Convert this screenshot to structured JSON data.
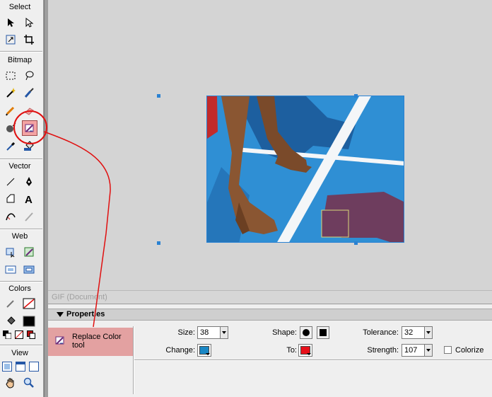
{
  "tools_panel": {
    "sections": [
      {
        "title": "Select"
      },
      {
        "title": "Bitmap"
      },
      {
        "title": "Vector"
      },
      {
        "title": "Web"
      },
      {
        "title": "Colors"
      },
      {
        "title": "View"
      }
    ]
  },
  "stage": {
    "document_label": "GIF (Document)"
  },
  "properties": {
    "title": "Properties",
    "tool_name": "Replace Color tool",
    "size_label": "Size:",
    "size_value": "38",
    "change_label": "Change:",
    "change_color": "#1a87c5",
    "shape_label": "Shape:",
    "to_label": "To:",
    "to_color": "#e8101a",
    "tolerance_label": "Tolerance:",
    "tolerance_value": "32",
    "strength_label": "Strength:",
    "strength_value": "107",
    "colorize_label": "Colorize",
    "colorize_checked": false
  },
  "colors": {
    "accent_highlight": "#f3a3a3",
    "annotation_red": "#e01010",
    "selection_blue": "#2a82d2"
  }
}
